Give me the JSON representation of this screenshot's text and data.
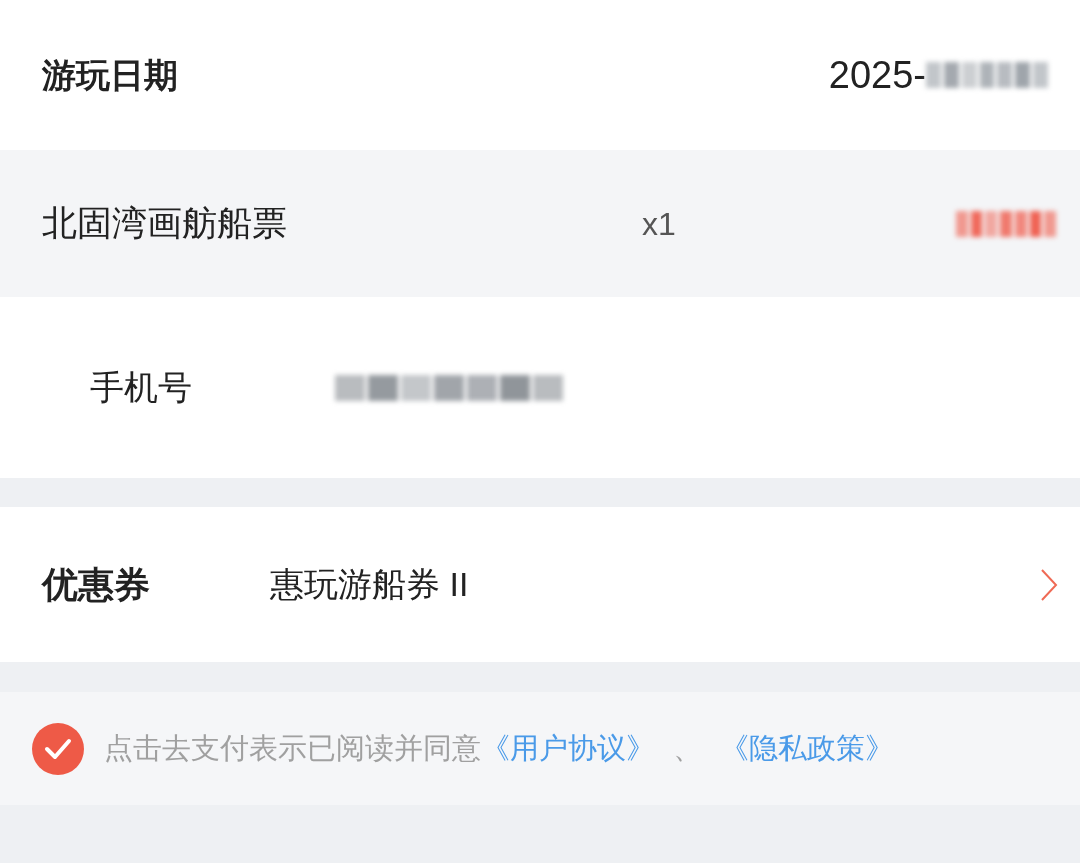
{
  "visit_date": {
    "label": "游玩日期",
    "value": "2025-"
  },
  "ticket": {
    "name": "北固湾画舫船票",
    "quantity": "x1"
  },
  "phone": {
    "label": "手机号"
  },
  "coupon": {
    "label": "优惠券",
    "value": "惠玩游船券 II"
  },
  "agreement": {
    "checked": true,
    "text": "点击去支付表示已阅读并同意",
    "links": [
      "《用户协议》",
      "《隐私政策》"
    ],
    "separator": "、"
  }
}
